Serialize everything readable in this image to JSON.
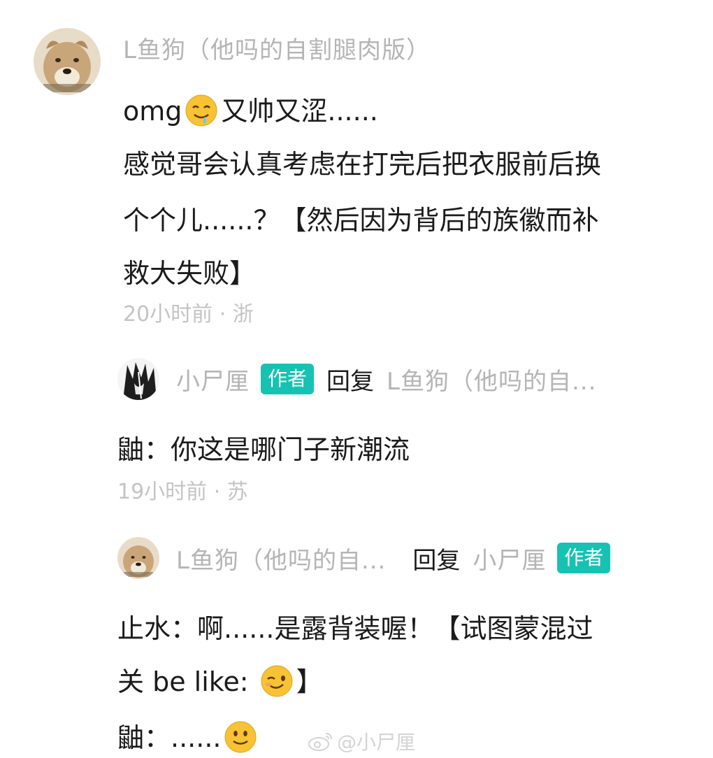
{
  "comment1": {
    "username": "L鱼狗（他吗的自割腿肉版）",
    "lines": [
      {
        "before": "omg",
        "emoji": "drooling-face-emoji",
        "after": "又帅又涩......"
      },
      {
        "text": "感觉哥会认真考虑在打完后把衣服前后换"
      },
      {
        "text": "个个儿......？【然后因为背后的族徽而补"
      },
      {
        "text": "救大失败】"
      }
    ],
    "meta": "20小时前 · 浙"
  },
  "comment2": {
    "username": "小尸厘",
    "badge": "作者",
    "reply_word": "回复",
    "reply_to": "L鱼狗（他吗的自...",
    "text": "鼬：你这是哪门子新潮流",
    "meta": "19小时前 · 苏"
  },
  "comment3": {
    "username": "L鱼狗（他吗的自...",
    "reply_word": "回复",
    "reply_to": "小尸厘",
    "badge": "作者",
    "lines": [
      {
        "text": "止水：啊......是露背装喔！【试图蒙混过"
      },
      {
        "before": "关 be like: ",
        "emoji": "winking-face-emoji",
        "after": "】"
      },
      {
        "before": "鼬：......",
        "emoji": "slightly-smiling-face-emoji",
        "after": ""
      }
    ]
  },
  "watermark": "@小尸厘",
  "colors": {
    "badge": "#17c2b2",
    "username": "#b5b5b5",
    "meta": "#c4c4c4",
    "text": "#1b1b1b"
  }
}
